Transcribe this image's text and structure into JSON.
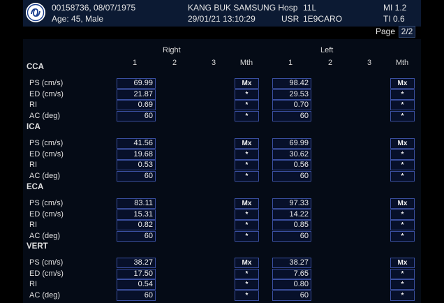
{
  "header": {
    "patient_id": "00158736, 08/07/1975",
    "age_sex": "Age: 45, Male",
    "hospital": "KANG BUK SAMSUNG Hosp",
    "probe": "11L",
    "datetime": "29/01/21 13:10:29",
    "user": "USR",
    "preset": "1E9CARO",
    "mi": "MI 1.2",
    "ti": "TI 0.6",
    "logo_icon": "ge-logo-icon"
  },
  "page": {
    "label": "Page",
    "value": "2/2"
  },
  "columns": {
    "right_label": "Right",
    "left_label": "Left",
    "headers": [
      "1",
      "2",
      "3",
      "Mth"
    ]
  },
  "sections": [
    {
      "title": "CCA",
      "rows": [
        {
          "label": "PS (cm/s)",
          "right": "69.99",
          "right_mth": "Mx",
          "left": "98.42",
          "left_mth": "Mx"
        },
        {
          "label": "ED (cm/s)",
          "right": "21.87",
          "right_mth": "*",
          "left": "29.53",
          "left_mth": "*"
        },
        {
          "label": "RI",
          "right": "0.69",
          "right_mth": "*",
          "left": "0.70",
          "left_mth": "*"
        },
        {
          "label": "AC (deg)",
          "right": "60",
          "right_mth": "*",
          "left": "60",
          "left_mth": "*"
        }
      ]
    },
    {
      "title": "ICA",
      "rows": [
        {
          "label": "PS (cm/s)",
          "right": "41.56",
          "right_mth": "Mx",
          "left": "69.99",
          "left_mth": "Mx"
        },
        {
          "label": "ED (cm/s)",
          "right": "19.68",
          "right_mth": "*",
          "left": "30.62",
          "left_mth": "*"
        },
        {
          "label": "RI",
          "right": "0.53",
          "right_mth": "*",
          "left": "0.56",
          "left_mth": "*"
        },
        {
          "label": "AC (deg)",
          "right": "60",
          "right_mth": "*",
          "left": "60",
          "left_mth": "*"
        }
      ]
    },
    {
      "title": "ECA",
      "rows": [
        {
          "label": "PS (cm/s)",
          "right": "83.11",
          "right_mth": "Mx",
          "left": "97.33",
          "left_mth": "Mx"
        },
        {
          "label": "ED (cm/s)",
          "right": "15.31",
          "right_mth": "*",
          "left": "14.22",
          "left_mth": "*"
        },
        {
          "label": "RI",
          "right": "0.82",
          "right_mth": "*",
          "left": "0.85",
          "left_mth": "*"
        },
        {
          "label": "AC (deg)",
          "right": "60",
          "right_mth": "*",
          "left": "60",
          "left_mth": "*"
        }
      ]
    },
    {
      "title": "VERT",
      "rows": [
        {
          "label": "PS (cm/s)",
          "right": "38.27",
          "right_mth": "Mx",
          "left": "38.27",
          "left_mth": "Mx"
        },
        {
          "label": "ED (cm/s)",
          "right": "17.50",
          "right_mth": "*",
          "left": "7.65",
          "left_mth": "*"
        },
        {
          "label": "RI",
          "right": "0.54",
          "right_mth": "*",
          "left": "0.80",
          "left_mth": "*"
        },
        {
          "label": "AC (deg)",
          "right": "60",
          "right_mth": "*",
          "left": "60",
          "left_mth": "*"
        }
      ]
    }
  ]
}
